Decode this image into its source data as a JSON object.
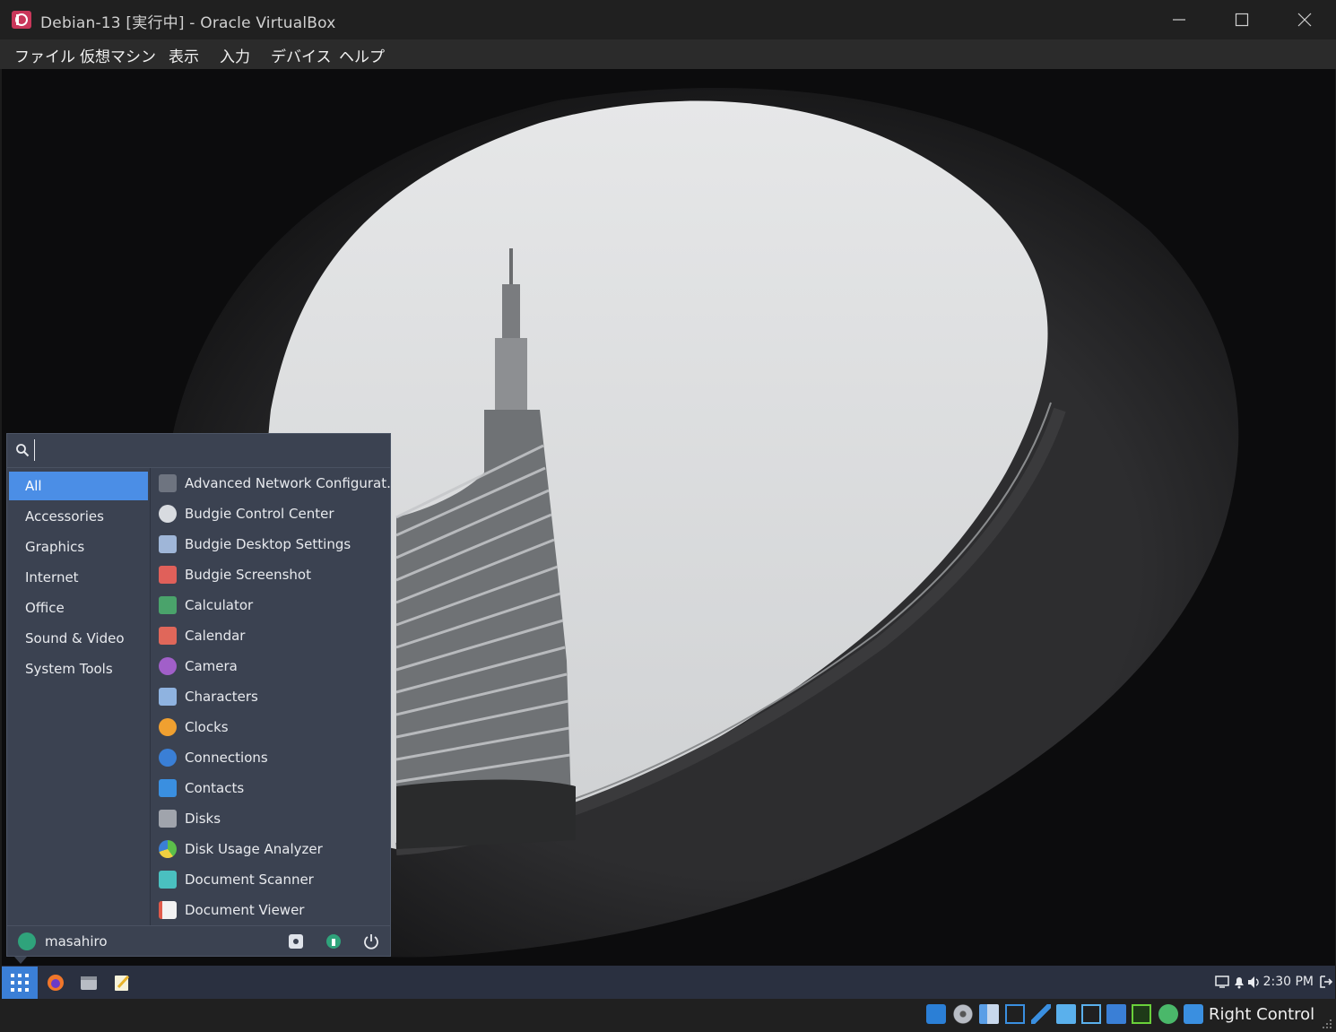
{
  "window": {
    "title": "Debian-13 [実行中] - Oracle VirtualBox",
    "controls": [
      "minimize",
      "maximize",
      "close"
    ]
  },
  "menubar": {
    "items": [
      "ファイル",
      "仮想マシン",
      "表示",
      "入力",
      "デバイス",
      "ヘルプ"
    ]
  },
  "app_menu": {
    "search": {
      "value": "",
      "placeholder": ""
    },
    "categories": [
      {
        "label": "All",
        "active": true
      },
      {
        "label": "Accessories"
      },
      {
        "label": "Graphics"
      },
      {
        "label": "Internet"
      },
      {
        "label": "Office"
      },
      {
        "label": "Sound & Video"
      },
      {
        "label": "System Tools"
      }
    ],
    "apps": [
      {
        "label": "Advanced Network Configurat...",
        "icon": "network-config-icon",
        "color": "#6e7480"
      },
      {
        "label": "Budgie Control Center",
        "icon": "gear-icon",
        "color": "#d8dbe0"
      },
      {
        "label": "Budgie Desktop Settings",
        "icon": "desktop-settings-icon",
        "color": "#9fb6d8"
      },
      {
        "label": "Budgie Screenshot",
        "icon": "camera-red-icon",
        "color": "#e0605a"
      },
      {
        "label": "Calculator",
        "icon": "calculator-icon",
        "color": "#4aa36b"
      },
      {
        "label": "Calendar",
        "icon": "calendar-icon",
        "color": "#e0675a"
      },
      {
        "label": "Camera",
        "icon": "camera-lens-icon",
        "color": "#a15fc9"
      },
      {
        "label": "Characters",
        "icon": "characters-icon",
        "color": "#8fb3e0"
      },
      {
        "label": "Clocks",
        "icon": "clock-icon",
        "color": "#f0a030"
      },
      {
        "label": "Connections",
        "icon": "connections-icon",
        "color": "#3a7fd6"
      },
      {
        "label": "Contacts",
        "icon": "contacts-icon",
        "color": "#3a8fe0"
      },
      {
        "label": "Disks",
        "icon": "disk-icon",
        "color": "#a0a4ac"
      },
      {
        "label": "Disk Usage Analyzer",
        "icon": "pie-chart-icon",
        "color": "#5cbf4a"
      },
      {
        "label": "Document Scanner",
        "icon": "scanner-icon",
        "color": "#4ac0c0"
      },
      {
        "label": "Document Viewer",
        "icon": "document-viewer-icon",
        "color": "#e05a4a"
      }
    ],
    "user": "masahiro",
    "footer_buttons": [
      "settings-icon",
      "lock-icon",
      "power-icon"
    ]
  },
  "panel": {
    "launchers": [
      "firefox-icon",
      "files-icon",
      "text-editor-icon"
    ],
    "clock": "2:30 PM",
    "tray_icons": [
      "display-icon",
      "bell-icon",
      "volume-icon",
      "logout-icon"
    ]
  },
  "statusbar": {
    "icons": [
      "hdd-icon",
      "optical-disk-icon",
      "audio-icon",
      "network-icon",
      "usb-icon",
      "shared-folder-icon",
      "display-icon",
      "recording-icon",
      "cpu-icon",
      "mouse-integration-icon",
      "keyboard-capture-icon"
    ],
    "host_key": "Right Control"
  },
  "colors": {
    "accent": "#4b8ee6",
    "menu_bg": "#3b4251",
    "panel_bg": "#2a3040"
  }
}
